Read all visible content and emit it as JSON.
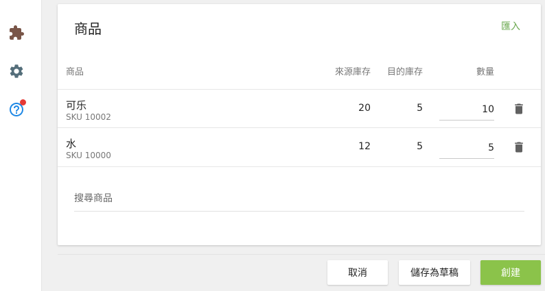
{
  "colors": {
    "accent": "#8bc34a",
    "link": "#6aa84f",
    "plugin_icon": "#795548",
    "settings_icon": "#546e7a",
    "help_icon": "#1e88e5",
    "notification_dot": "#e53935"
  },
  "sidebar": {
    "icons": [
      "puzzle-icon",
      "gear-icon",
      "help-icon"
    ]
  },
  "card": {
    "title": "商品",
    "import_label": "匯入",
    "columns": {
      "product": "商品",
      "source_stock": "來源庫存",
      "target_stock": "目的庫存",
      "quantity": "數量"
    },
    "rows": [
      {
        "name": "可乐",
        "sku": "SKU 10002",
        "source_stock": "20",
        "target_stock": "5",
        "quantity": "10"
      },
      {
        "name": "水",
        "sku": "SKU 10000",
        "source_stock": "12",
        "target_stock": "5",
        "quantity": "5"
      }
    ],
    "search_placeholder": "搜尋商品"
  },
  "footer": {
    "cancel_label": "取消",
    "save_draft_label": "儲存為草稿",
    "create_label": "創建"
  }
}
